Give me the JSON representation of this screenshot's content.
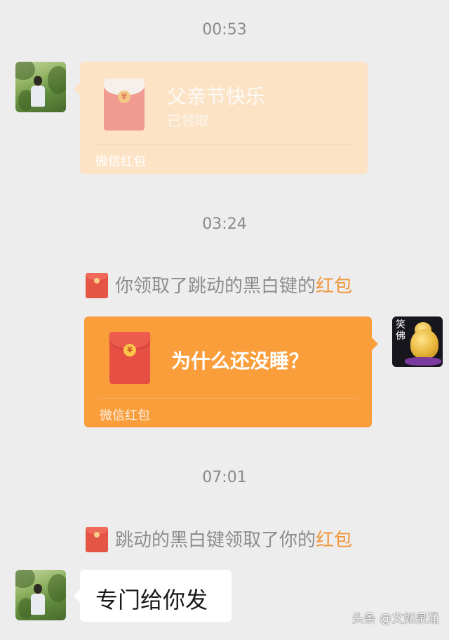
{
  "timestamps": [
    "00:53",
    "03:24",
    "07:01"
  ],
  "messages": {
    "red_packet_received": {
      "title": "父亲节快乐",
      "status": "已领取",
      "footer": "微信红包",
      "icon": "red-envelope-icon",
      "state": "claimed"
    },
    "system_1": {
      "text": "你领取了跳动的黑白键的",
      "link": "红包",
      "icon": "red-envelope-icon"
    },
    "red_packet_sent": {
      "title": "为什么还没睡？",
      "footer": "微信红包",
      "icon": "red-envelope-icon",
      "state": "unclaimed"
    },
    "system_2": {
      "text": "跳动的黑白键领取了你的",
      "link": "红包",
      "icon": "red-envelope-icon"
    },
    "text_message": {
      "text": "专门给你发"
    }
  },
  "avatars": {
    "contact": "avatar-forest-person",
    "me": "avatar-laughing-buddha",
    "me_label": "笑佛"
  },
  "watermark": "头条 @文如泉涌",
  "colors": {
    "background": "#ededed",
    "red_packet_claimed": "#fde3c6",
    "red_packet_active": "#fa9d3b",
    "link": "#f0963a"
  }
}
